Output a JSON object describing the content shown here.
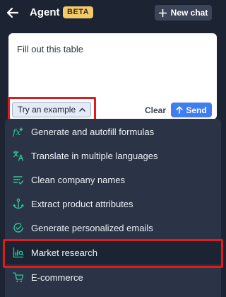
{
  "header": {
    "title": "Agent",
    "badge": "BETA",
    "new_chat_label": "New chat"
  },
  "prompt": {
    "text": "Fill out this table",
    "example_button_label": "Try an example",
    "clear_label": "Clear",
    "send_label": "Send"
  },
  "menu": {
    "items": [
      {
        "label": "Generate and autofill formulas",
        "icon": "formula-icon"
      },
      {
        "label": "Translate in multiple languages",
        "icon": "translate-icon"
      },
      {
        "label": "Clean company names",
        "icon": "clean-list-icon"
      },
      {
        "label": "Extract product attributes",
        "icon": "anchor-icon"
      },
      {
        "label": "Generate personalized emails",
        "icon": "email-icon"
      },
      {
        "label": "Market research",
        "icon": "chart-search-icon",
        "selected": true
      },
      {
        "label": "E-commerce",
        "icon": "cart-icon"
      }
    ]
  },
  "colors": {
    "background": "#1c2433",
    "menu_background": "#2a3446",
    "accent_icon": "#2fc79a",
    "send_button": "#3f7df0",
    "badge": "#f3c969",
    "highlight": "#e01b1b"
  }
}
